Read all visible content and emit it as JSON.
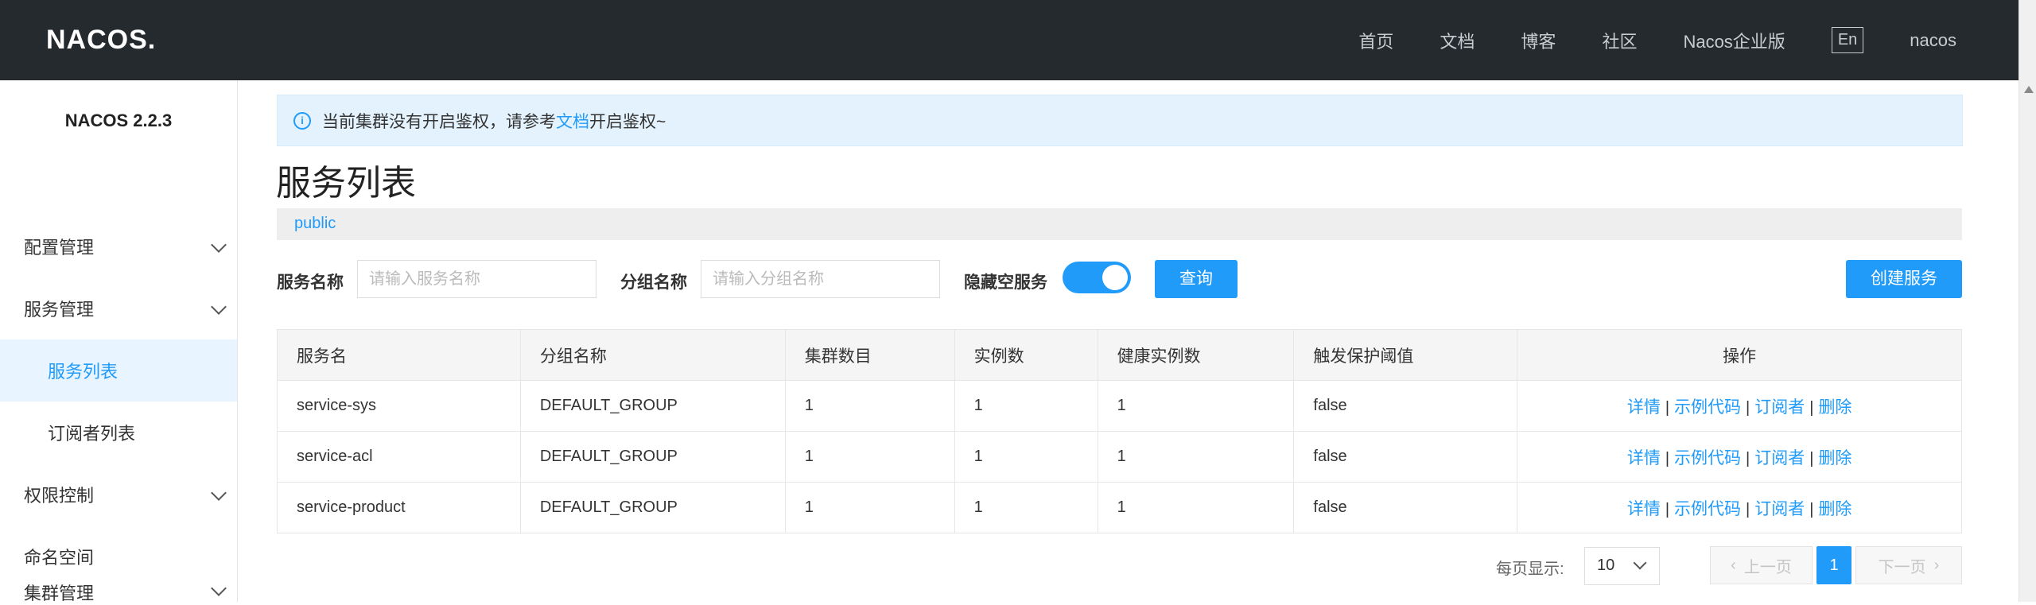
{
  "header": {
    "logo": "NACOS.",
    "nav": [
      "首页",
      "文档",
      "博客",
      "社区",
      "Nacos企业版"
    ],
    "lang": "En",
    "user": "nacos"
  },
  "sidebar": {
    "version": "NACOS 2.2.3",
    "items": [
      {
        "label": "配置管理"
      },
      {
        "label": "服务管理"
      },
      {
        "label": "服务列表"
      },
      {
        "label": "订阅者列表"
      },
      {
        "label": "权限控制"
      },
      {
        "label": "命名空间"
      },
      {
        "label": "集群管理"
      }
    ]
  },
  "notice": {
    "text_before": "当前集群没有开启鉴权，请参考",
    "link": "文档",
    "text_after": "开启鉴权~"
  },
  "page": {
    "title": "服务列表",
    "namespace": "public"
  },
  "filters": {
    "service_label": "服务名称",
    "service_placeholder": "请输入服务名称",
    "group_label": "分组名称",
    "group_placeholder": "请输入分组名称",
    "hide_empty_label": "隐藏空服务",
    "hide_empty_on": true,
    "query_button": "查询",
    "create_button": "创建服务"
  },
  "table": {
    "columns": [
      "服务名",
      "分组名称",
      "集群数目",
      "实例数",
      "健康实例数",
      "触发保护阈值",
      "操作"
    ],
    "rows": [
      [
        "service-sys",
        "DEFAULT_GROUP",
        "1",
        "1",
        "1",
        "false"
      ],
      [
        "service-acl",
        "DEFAULT_GROUP",
        "1",
        "1",
        "1",
        "false"
      ],
      [
        "service-product",
        "DEFAULT_GROUP",
        "1",
        "1",
        "1",
        "false"
      ]
    ],
    "ops": [
      "详情",
      "示例代码",
      "订阅者",
      "删除"
    ]
  },
  "pagination": {
    "per_page_label": "每页显示:",
    "per_page": "10",
    "prev": "上一页",
    "current": "1",
    "next": "下一页"
  },
  "colors": {
    "accent": "#209bfa",
    "topbar": "#252a2f"
  }
}
